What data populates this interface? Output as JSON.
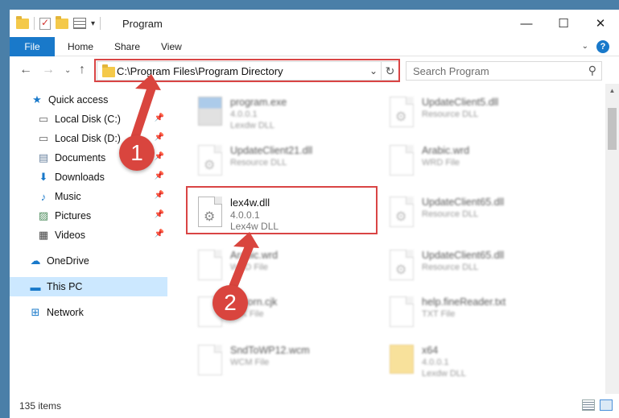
{
  "window": {
    "title": "Program",
    "controls": {
      "minimize": "—",
      "maximize": "☐",
      "close": "✕"
    }
  },
  "ribbon": {
    "tabs": [
      "File",
      "Home",
      "Share",
      "View"
    ],
    "help": "?"
  },
  "navigation": {
    "address": "C:\\Program Files\\Program Directory",
    "search_placeholder": "Search Program"
  },
  "sidebar": {
    "items": [
      {
        "label": "Quick access",
        "icon": "star-icon",
        "pinned": false
      },
      {
        "label": "Local Disk (C:)",
        "icon": "drive-icon",
        "pinned": true
      },
      {
        "label": "Local Disk (D:)",
        "icon": "drive-icon",
        "pinned": true
      },
      {
        "label": "Documents",
        "icon": "documents-icon",
        "pinned": true
      },
      {
        "label": "Downloads",
        "icon": "download-icon",
        "pinned": true
      },
      {
        "label": "Music",
        "icon": "music-icon",
        "pinned": true
      },
      {
        "label": "Pictures",
        "icon": "pictures-icon",
        "pinned": true
      },
      {
        "label": "Videos",
        "icon": "videos-icon",
        "pinned": true
      },
      {
        "label": "OneDrive",
        "icon": "cloud-icon",
        "pinned": false
      },
      {
        "label": "This PC",
        "icon": "pc-icon",
        "pinned": false,
        "selected": true
      },
      {
        "label": "Network",
        "icon": "network-icon",
        "pinned": false
      }
    ]
  },
  "files": [
    {
      "name": "program.exe",
      "line1": "4.0.0.1",
      "line2": "Lexdw DLL",
      "icon": "exe-icon"
    },
    {
      "name": "UpdateClient5.dll",
      "line1": "Resource DLL",
      "line2": "",
      "icon": "dll-icon"
    },
    {
      "name": "UpdateClient21.dll",
      "line1": "Resource DLL",
      "line2": "",
      "icon": "dll-icon"
    },
    {
      "name": "Arabic.wrd",
      "line1": "WRD File",
      "line2": "",
      "icon": "file-icon"
    },
    {
      "name": "lex4w.dll",
      "line1": "4.0.0.1",
      "line2": "Lex4w DLL",
      "icon": "dll-icon",
      "highlighted": true
    },
    {
      "name": "UpdateClient65.dll",
      "line1": "Resource DLL",
      "line2": "",
      "icon": "dll-icon"
    },
    {
      "name": "Arabic.wrd",
      "line1": "WRD File",
      "line2": "",
      "icon": "file-icon"
    },
    {
      "name": "UpdateClient65.dll",
      "line1": "Resource DLL",
      "line2": "",
      "icon": "dll-icon"
    },
    {
      "name": "DICorn.cjk",
      "line1": "CJK File",
      "line2": "",
      "icon": "file-icon"
    },
    {
      "name": "help.fineReader.txt",
      "line1": "TXT File",
      "line2": "",
      "icon": "file-icon"
    },
    {
      "name": "SndToWP12.wcm",
      "line1": "WCM File",
      "line2": "",
      "icon": "file-icon"
    },
    {
      "name": "x64",
      "line1": "4.0.0.1",
      "line2": "Lexdw DLL",
      "icon": "folder-icon"
    }
  ],
  "status": {
    "item_count": "135 items"
  },
  "annotations": {
    "step1": "1",
    "step2": "2"
  },
  "colors": {
    "accent": "#1979ca",
    "highlight_box": "#d94545",
    "badge": "#d9453e",
    "selection": "#cce8ff"
  }
}
